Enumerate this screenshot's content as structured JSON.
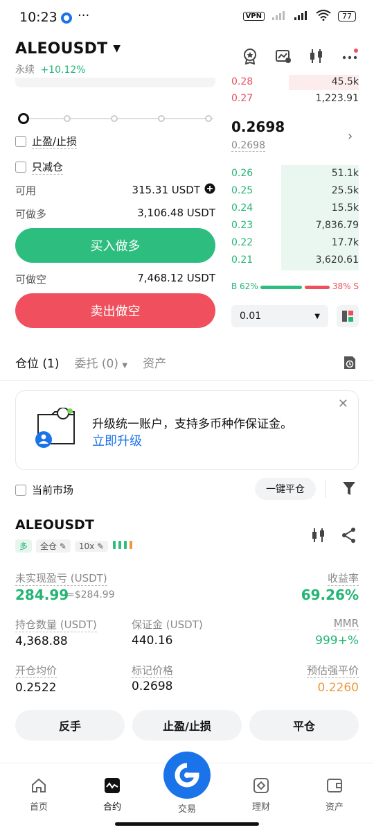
{
  "status": {
    "time": "10:23",
    "vpn": "VPN",
    "battery": "77",
    "more": "···"
  },
  "header": {
    "pair": "ALEOUSDT",
    "type": "永续",
    "change": "+10.12%"
  },
  "form": {
    "tpsl_label": "止盈/止损",
    "reduce_only_label": "只减仓",
    "available_label": "可用",
    "available_value": "315.31 USDT",
    "can_long_label": "可做多",
    "can_long_value": "3,106.48 USDT",
    "buy_label": "买入做多",
    "can_short_label": "可做空",
    "can_short_value": "7,468.12 USDT",
    "sell_label": "卖出做空"
  },
  "orderbook": {
    "asks": [
      {
        "price": "0.28",
        "qty": "45.5k",
        "depth": 0.55
      },
      {
        "price": "0.27",
        "qty": "1,223.91",
        "depth": 0.0
      }
    ],
    "last_price": "0.2698",
    "mark_price": "0.2698",
    "bids": [
      {
        "price": "0.26",
        "qty": "51.1k",
        "depth": 0.62
      },
      {
        "price": "0.25",
        "qty": "25.5k",
        "depth": 0.62
      },
      {
        "price": "0.24",
        "qty": "15.5k",
        "depth": 0.62
      },
      {
        "price": "0.23",
        "qty": "7,836.79",
        "depth": 0.62
      },
      {
        "price": "0.22",
        "qty": "17.7k",
        "depth": 0.62
      },
      {
        "price": "0.21",
        "qty": "3,620.61",
        "depth": 0.62
      }
    ],
    "buy_pct_label": "B 62%",
    "sell_pct_label": "38% S",
    "buy_ratio": 0.62,
    "precision": "0.01"
  },
  "tabs": {
    "positions": "仓位 (1)",
    "orders": "委托 (0)",
    "assets": "资产"
  },
  "banner": {
    "text": "升级统一账户，支持多币种作保证金。",
    "link": "立即升级"
  },
  "filter": {
    "current_market": "当前市场",
    "close_all": "一键平仓"
  },
  "position": {
    "pair": "ALEOUSDT",
    "side": "多",
    "margin_mode": "全仓",
    "leverage": "10x",
    "upnl_label": "未实现盈亏 (USDT)",
    "upnl_value": "284.99",
    "upnl_usd": "≈$284.99",
    "roi_label": "收益率",
    "roi_value": "69.26%",
    "size_label": "持仓数量 (USDT)",
    "size_value": "4,368.88",
    "margin_label": "保证金 (USDT)",
    "margin_value": "440.16",
    "mmr_label": "MMR",
    "mmr_value": "999+%",
    "entry_label": "开仓均价",
    "entry_value": "0.2522",
    "markp_label": "标记价格",
    "markp_value": "0.2698",
    "liq_label": "预估强平价",
    "liq_value": "0.2260",
    "btn_reverse": "反手",
    "btn_tpsl": "止盈/止损",
    "btn_close": "平仓"
  },
  "nav": {
    "home": "首页",
    "futures": "合约",
    "trade": "交易",
    "earn": "理财",
    "assets": "资产"
  },
  "colors": {
    "green": "#2dbd7e",
    "red": "#f0505e",
    "blue": "#1a73e8",
    "orange": "#f0963a"
  }
}
